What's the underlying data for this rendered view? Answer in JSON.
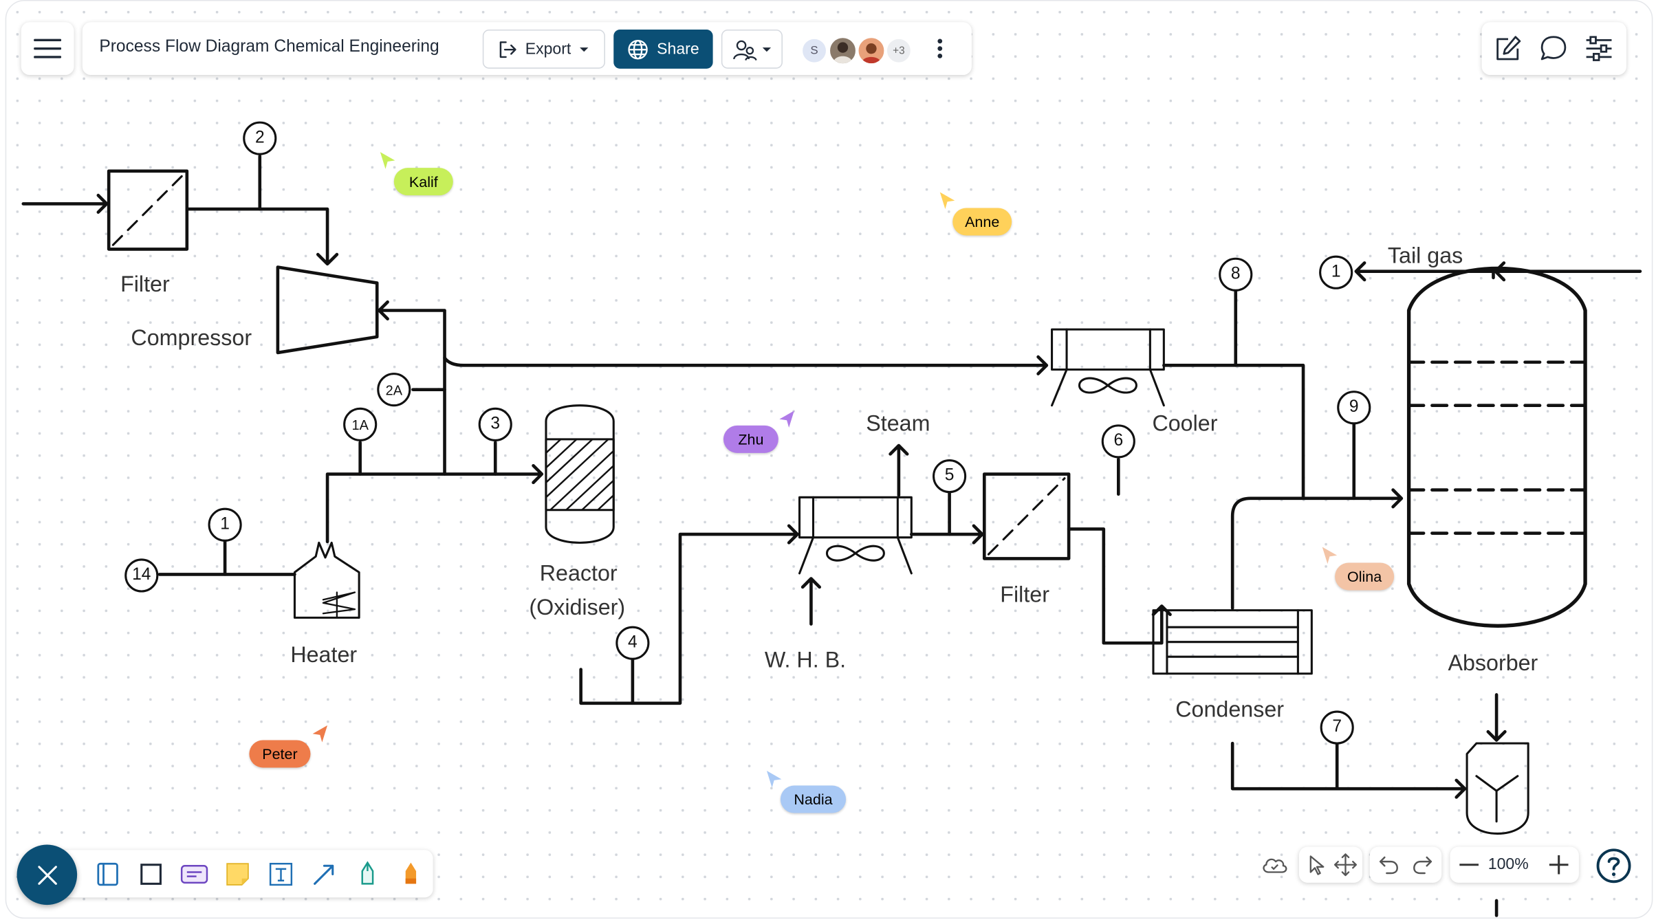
{
  "header": {
    "title": "Process Flow Diagram Chemical Engineering",
    "export_label": "Export",
    "share_label": "Share",
    "avatar_initial": "S",
    "more_count": "+3"
  },
  "labels": {
    "filter_top": "Filter",
    "compressor": "Compressor",
    "heater": "Heater",
    "reactor_line1": "Reactor",
    "reactor_line2": "(Oxidiser)",
    "steam": "Steam",
    "whb": "W. H. B.",
    "filter_mid": "Filter",
    "cooler": "Cooler",
    "condenser": "Condenser",
    "tail_gas": "Tail gas",
    "absorber": "Absorber"
  },
  "bubbles": {
    "b2": "2",
    "b2a": "2A",
    "b1a": "1A",
    "b3": "3",
    "b1_left": "1",
    "b14": "14",
    "b4": "4",
    "b5": "5",
    "b6": "6",
    "b8": "8",
    "b1_right": "1",
    "b9": "9",
    "b7": "7"
  },
  "cursors": {
    "kalif": "Kalif",
    "anne": "Anne",
    "zhu": "Zhu",
    "olina": "Olina",
    "peter": "Peter",
    "nadia": "Nadia"
  },
  "footer": {
    "zoom": "100%"
  },
  "colors": {
    "share_bg": "#0b4f75",
    "fab_bg": "#0b4f75",
    "kalif": "#c7ef5a",
    "anne": "#ffd15a",
    "zhu": "#b07ce8",
    "olina": "#f3c4a6",
    "peter": "#ee7c4a",
    "nadia": "#a9c9f5"
  }
}
